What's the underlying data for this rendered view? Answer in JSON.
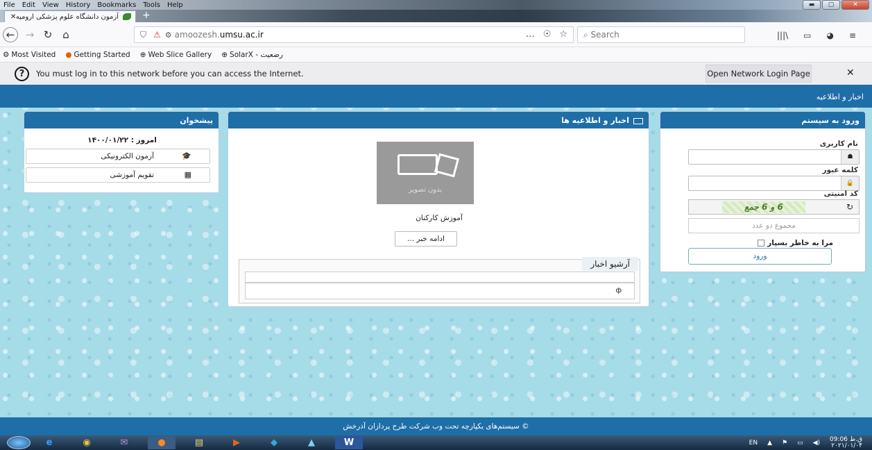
{
  "menu": {
    "items": [
      "File",
      "Edit",
      "View",
      "History",
      "Bookmarks",
      "Tools",
      "Help"
    ]
  },
  "window_controls": {
    "minimize": "▬",
    "maximize": "▢",
    "close": "✕"
  },
  "tab": {
    "title": "آزمون دانشگاه علوم پزشکی ارومیه",
    "close": "✕",
    "new": "+"
  },
  "nav": {
    "back": "←",
    "forward": "→",
    "reload": "↻",
    "home": "⌂"
  },
  "url": {
    "prefix": "amoozesh.",
    "domain": "umsu.ac.ir",
    "actions": [
      "…",
      "☉",
      "☆"
    ]
  },
  "search": {
    "placeholder": "Search"
  },
  "bookmarks": [
    "Most Visited",
    "Getting Started",
    "Web Slice Gallery",
    "SolarX - رضعیت"
  ],
  "notice": {
    "text": "You must log in to this network before you can access the Internet.",
    "button": "Open Network Login Page",
    "close": "✕"
  },
  "topnav": {
    "label": "اخبار و اطلاعیه"
  },
  "login": {
    "title": "ورود به سیستم",
    "username_label": "نام کاربری",
    "password_label": "کلمه عبور",
    "captcha_label": "کد امنیتی",
    "captcha_text": "6 و 6 جمع",
    "captcha_sum_placeholder": "مجموع دو عدد",
    "remember": "مرا به خاطر بسپار",
    "submit": "ورود"
  },
  "news": {
    "title": "اخبار و اطلاعیه ها",
    "no_image": "بدون تصویر",
    "item_title": "آموزش کارکنان",
    "more": "ادامه خبر ...",
    "archive_title": "آرشیو اخبار",
    "archive_item": "ф"
  },
  "counter": {
    "title": "پیشخوان",
    "today": "امروز : ۱۴۰۰/۰۱/۲۲",
    "items": [
      {
        "label": "آزمون الکترونیکی",
        "icon": "graduation-cap-icon"
      },
      {
        "label": "تقویم آموزشی",
        "icon": "calendar-icon"
      }
    ]
  },
  "footer": {
    "text": "© سیستم‌های یکپارچه تحت وب شرکت طرح پردازان آذرخش"
  },
  "taskbar": {
    "apps": [
      "e",
      "◉",
      "✉",
      "●",
      "▤",
      "▶",
      "◆",
      "▲",
      "W"
    ],
    "lang": "EN",
    "time": "09:06 ق.ظ",
    "date": "۲۰۲۱/۰۱/۰۴"
  }
}
